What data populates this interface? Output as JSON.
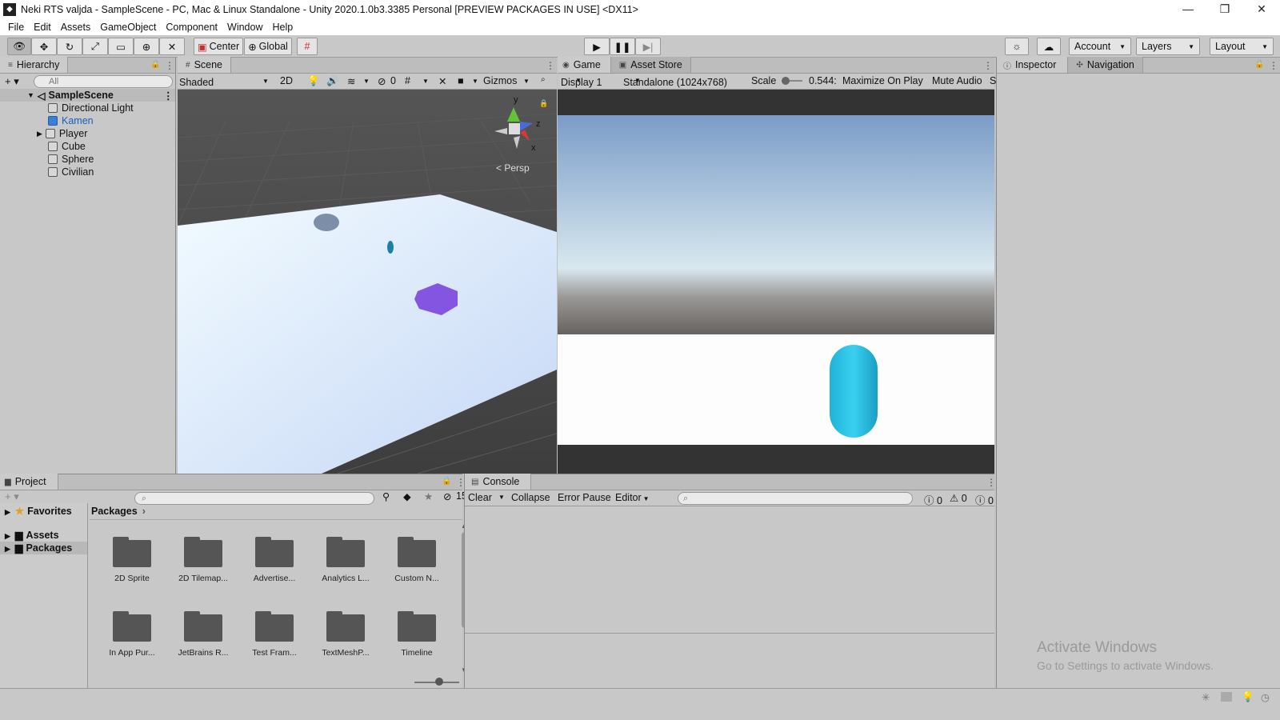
{
  "window": {
    "title": "Neki RTS valjda - SampleScene - PC, Mac & Linux Standalone - Unity 2020.1.0b3.3385 Personal [PREVIEW PACKAGES IN USE] <DX11>",
    "minimize": "—",
    "restore": "❐",
    "close": "✕"
  },
  "menu": [
    "File",
    "Edit",
    "Assets",
    "GameObject",
    "Component",
    "Window",
    "Help"
  ],
  "toolbar": {
    "pivot": "Center",
    "space": "Global",
    "account": "Account",
    "layers": "Layers",
    "layout": "Layout"
  },
  "hierarchy": {
    "tab": "Hierarchy",
    "search_placeholder": "All",
    "scene": "SampleScene",
    "items": [
      "Directional Light",
      "Kamen",
      "Player",
      "Cube",
      "Sphere",
      "Civilian"
    ]
  },
  "scene": {
    "tab": "Scene",
    "shading": "Shaded",
    "mode_2d": "2D",
    "hidden_count": "0",
    "gizmos": "Gizmos",
    "persp": "< Persp",
    "axis_y": "y",
    "axis_z": "z",
    "axis_x": "x"
  },
  "game": {
    "tab": "Game",
    "tab2": "Asset Store",
    "display": "Display 1",
    "resolution": "Standalone (1024x768)",
    "scale_label": "Scale",
    "scale_value": "0.544:",
    "maximize": "Maximize On Play",
    "mute": "Mute Audio",
    "trunc": "S"
  },
  "inspector": {
    "tab": "Inspector",
    "tab2": "Navigation"
  },
  "project": {
    "tab": "Project",
    "hidden_count": "15",
    "favorites": "Favorites",
    "assets": "Assets",
    "packages": "Packages",
    "breadcrumb": "Packages",
    "folders": [
      "2D Sprite",
      "2D Tilemap...",
      "Advertise...",
      "Analytics L...",
      "Custom N...",
      "In App Pur...",
      "JetBrains R...",
      "Test Fram...",
      "TextMeshP...",
      "Timeline"
    ]
  },
  "console": {
    "tab": "Console",
    "clear": "Clear",
    "collapse": "Collapse",
    "error_pause": "Error Pause",
    "editor": "Editor",
    "errors": "0",
    "warnings": "0",
    "infos": "0"
  },
  "watermark": {
    "line1": "Activate Windows",
    "line2": "Go to Settings to activate Windows."
  }
}
